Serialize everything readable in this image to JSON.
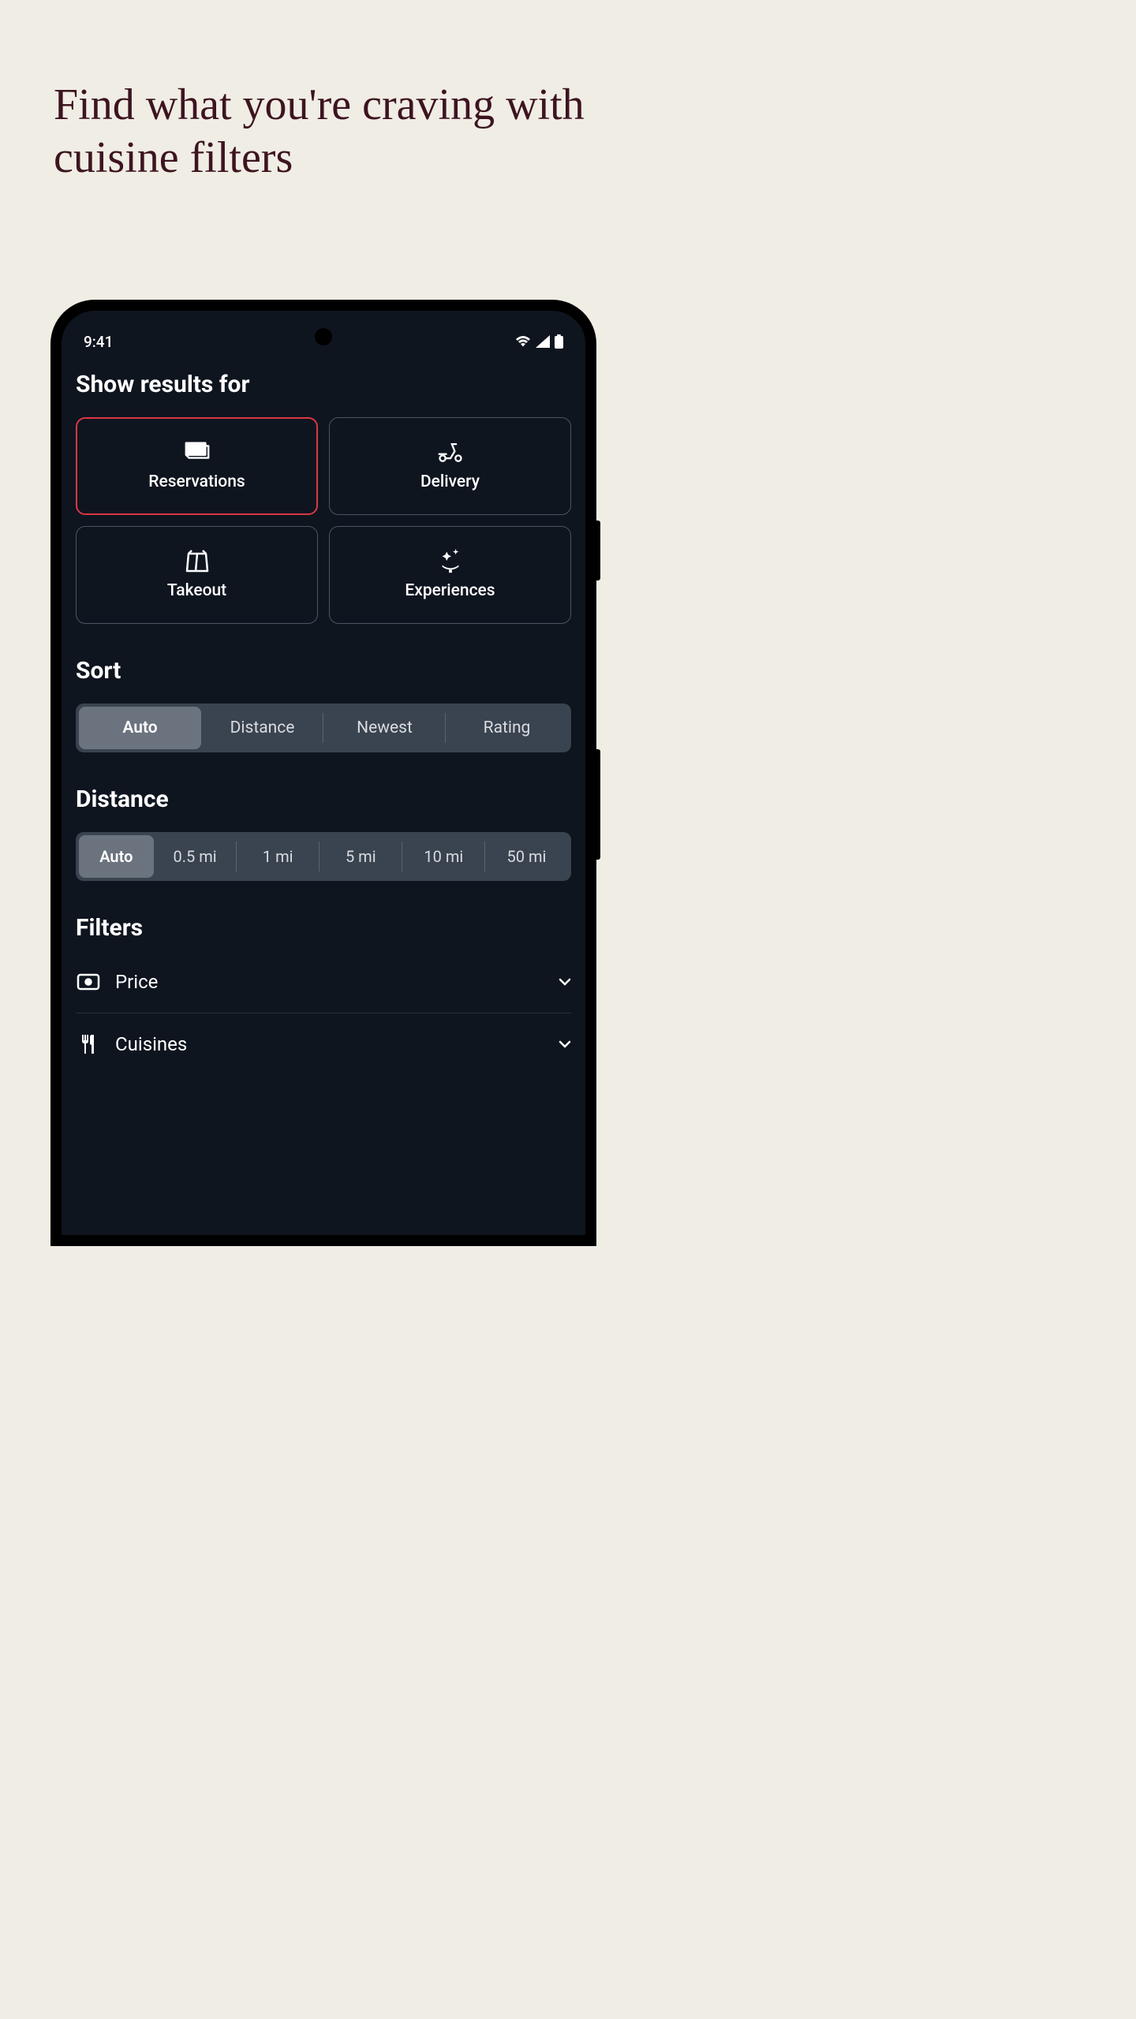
{
  "headline": "Find what you're craving with cuisine filters",
  "status_bar": {
    "time": "9:41"
  },
  "show_results": {
    "title": "Show results for",
    "options": [
      {
        "label": "Reservations",
        "selected": true,
        "icon": "menu-card"
      },
      {
        "label": "Delivery",
        "selected": false,
        "icon": "scooter"
      },
      {
        "label": "Takeout",
        "selected": false,
        "icon": "bag"
      },
      {
        "label": "Experiences",
        "selected": false,
        "icon": "sparkle-dish"
      }
    ]
  },
  "sort": {
    "title": "Sort",
    "options": [
      "Auto",
      "Distance",
      "Newest",
      "Rating"
    ],
    "selected": "Auto"
  },
  "distance": {
    "title": "Distance",
    "options": [
      "Auto",
      "0.5 mi",
      "1 mi",
      "5 mi",
      "10 mi",
      "50 mi"
    ],
    "selected": "Auto"
  },
  "filters": {
    "title": "Filters",
    "rows": [
      {
        "label": "Price",
        "icon": "cash"
      },
      {
        "label": "Cuisines",
        "icon": "utensils"
      }
    ]
  }
}
